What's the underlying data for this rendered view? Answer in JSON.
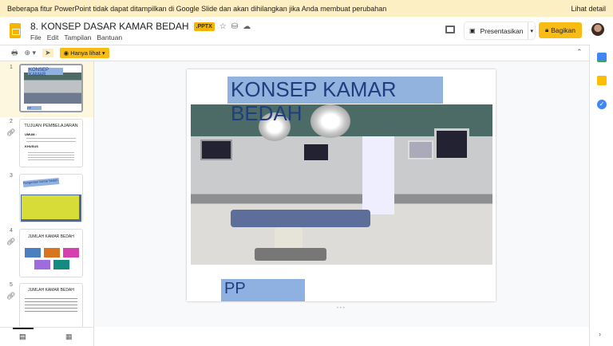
{
  "banner": {
    "message": "Beberapa fitur PowerPoint tidak dapat ditampilkan di Google Slide dan akan dihilangkan jika Anda membuat perubahan",
    "details_link": "Lihat detail"
  },
  "doc": {
    "title": "8. KONSEP DASAR KAMAR BEDAH",
    "badge": ".PPTX"
  },
  "menu": [
    "File",
    "Edit",
    "Tampilan",
    "Bantuan"
  ],
  "header": {
    "present_label": "Presentasikan",
    "share_label": "Bagikan"
  },
  "toolbar": {
    "view_mode": "Hanya lihat"
  },
  "slides": [
    {
      "num": "1",
      "title": "KONSEP KAMAR",
      "sub": "PP"
    },
    {
      "num": "2",
      "title": "TUJUAN PEMBELAJARAN",
      "lines": [
        "UMUM :",
        "KHUSUS"
      ]
    },
    {
      "num": "3",
      "title": "Pengertian kamar bedah"
    },
    {
      "num": "4",
      "title": "JUMLAH KAMAR BEDAH"
    },
    {
      "num": "5",
      "title": "JUMLAH KAMAR BEDAH"
    }
  ],
  "main_slide": {
    "title": "KONSEP KAMAR BEDAH",
    "subtitle": "PP HIPKABI"
  }
}
